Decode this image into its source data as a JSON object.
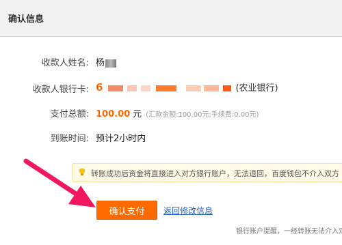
{
  "header": {
    "title": "确认信息"
  },
  "fields": {
    "payee_name": {
      "label": "收款人姓名:",
      "value": "杨"
    },
    "bank_card": {
      "label": "收款人银行卡:",
      "value_visible": "6",
      "bank": "(农业银行)"
    },
    "amount": {
      "label": "支付总额:",
      "value": "100.00",
      "unit": "元",
      "fee_note": "(汇款金额:100.00元;手续费:0.00元)"
    },
    "arrival": {
      "label": "到账时间:",
      "value": "预计2小时内"
    }
  },
  "notice": {
    "text": "转账成功后资金将直接进入对方银行账户，无法退回，百度钱包不介入双方",
    "icon": "lightbulb-icon"
  },
  "actions": {
    "confirm_label": "确认支付",
    "back_label": "返回修改信息"
  },
  "footnote": "银行账户提醒，一经转账无法介入双方",
  "colors": {
    "accent": "#ff6a00",
    "link": "#1f5fbf",
    "arrow": "#f0165f",
    "notice_bg": "#fffbe6"
  }
}
